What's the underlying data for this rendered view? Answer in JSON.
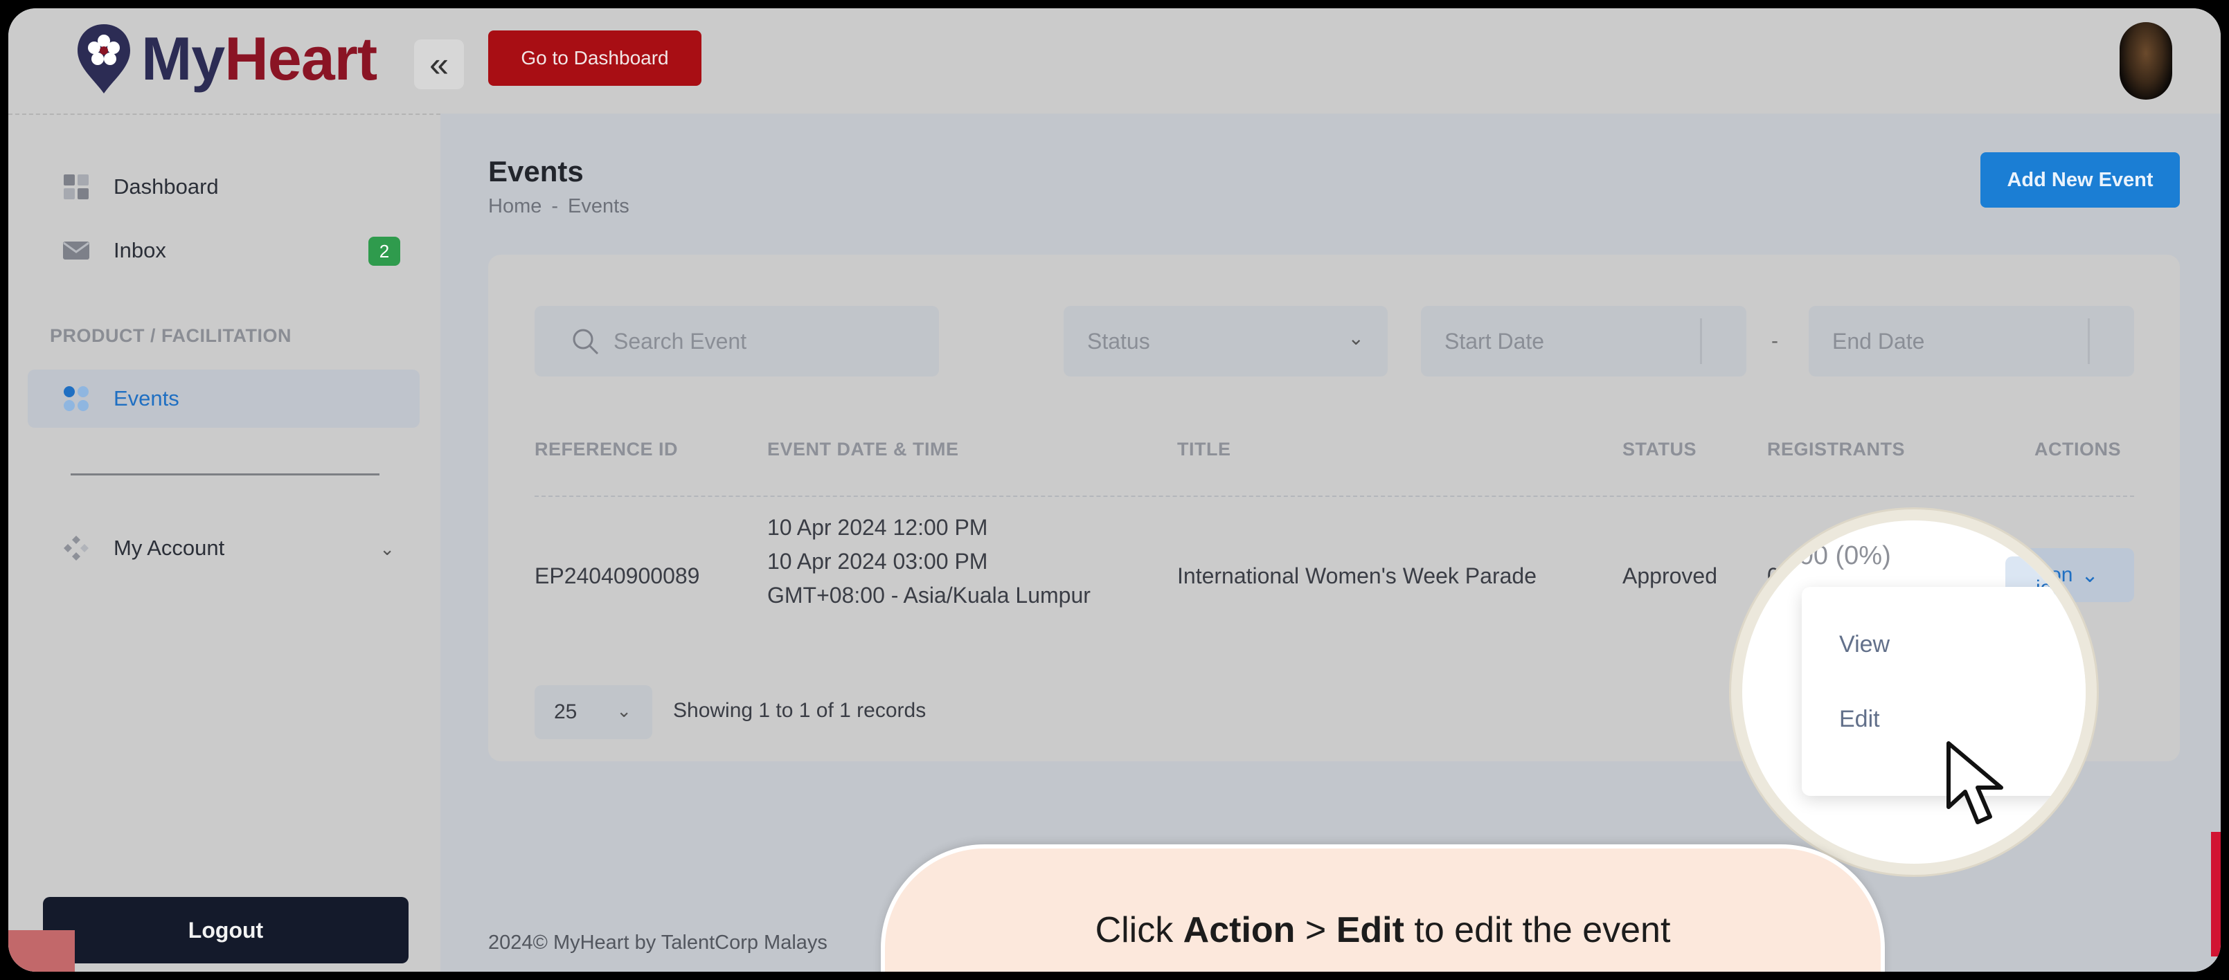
{
  "app": {
    "logo_my": "My",
    "logo_heart": "Heart",
    "collapse_glyph": "«",
    "dashboard_button": "Go to Dashboard"
  },
  "sidebar": {
    "items": [
      {
        "label": "Dashboard",
        "icon": "dashboard-icon"
      },
      {
        "label": "Inbox",
        "icon": "mail-icon",
        "badge": "2"
      },
      {
        "label": "Events",
        "icon": "events-icon",
        "active": true
      },
      {
        "label": "My Account",
        "icon": "account-icon"
      }
    ],
    "section_label": "PRODUCT / FACILITATION",
    "logout": "Logout"
  },
  "page": {
    "title": "Events",
    "breadcrumb": [
      "Home",
      "-",
      "Events"
    ],
    "add_button": "Add New Event"
  },
  "filters": {
    "search_placeholder": "Search Event",
    "status_placeholder": "Status",
    "start_date_placeholder": "Start Date",
    "end_date_placeholder": "End Date",
    "date_separator": "-"
  },
  "table": {
    "columns": [
      "REFERENCE ID",
      "EVENT DATE & TIME",
      "TITLE",
      "STATUS",
      "REGISTRANTS",
      "ACTIONS"
    ],
    "rows": [
      {
        "reference_id": "EP24040900089",
        "date_lines": [
          "10 Apr 2024 12:00 PM",
          "10 Apr 2024 03:00 PM",
          "GMT+08:00 - Asia/Kuala Lumpur"
        ],
        "title": "International Women's Week Parade",
        "status": "Approved",
        "registrants": "0",
        "action_label": "ion"
      }
    ],
    "per_page": "25",
    "records_info": "Showing 1 to 1 of 1 records"
  },
  "footer": {
    "year": "2024©",
    "text": "MyHeart by TalentCorp Malays"
  },
  "magnifier": {
    "registrants_partial": "0  00 (0%)",
    "action_label": "ion",
    "dropdown": [
      "View",
      "Edit"
    ]
  },
  "caption": {
    "part1": "Click ",
    "bold1": "Action",
    "part2": " > ",
    "bold2": "Edit",
    "part3": " to edit the event"
  },
  "colors": {
    "brand_red": "#a80e14",
    "brand_blue": "#1b7ed4",
    "badge_green": "#2f9b4d",
    "caption_bg": "#fce8dc"
  }
}
